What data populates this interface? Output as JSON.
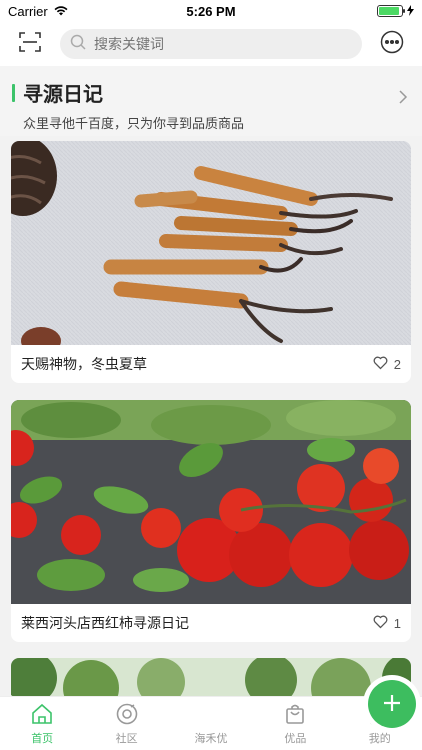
{
  "status": {
    "carrier": "Carrier",
    "time": "5:26 PM",
    "battery_pct": 0.9
  },
  "header": {
    "scan_icon": "scan-icon",
    "search_placeholder": "搜索关键词",
    "more_icon": "more-dots-icon"
  },
  "section": {
    "title": "寻源日记",
    "subtitle": "众里寻他千百度，只为你寻到品质商品",
    "accent_color": "#3cc36a"
  },
  "cards": [
    {
      "title": "天赐神物，冬虫夏草",
      "likes": "2"
    },
    {
      "title": "莱西河头店西红柿寻源日记",
      "likes": "1"
    }
  ],
  "tabbar": {
    "tabs": [
      {
        "label": "首页",
        "icon": "home-icon",
        "active": true
      },
      {
        "label": "社区",
        "icon": "community-icon"
      },
      {
        "label": "海禾优",
        "icon": "plus-icon"
      },
      {
        "label": "优品",
        "icon": "bag-icon"
      },
      {
        "label": "我的",
        "icon": "profile-icon"
      }
    ]
  }
}
